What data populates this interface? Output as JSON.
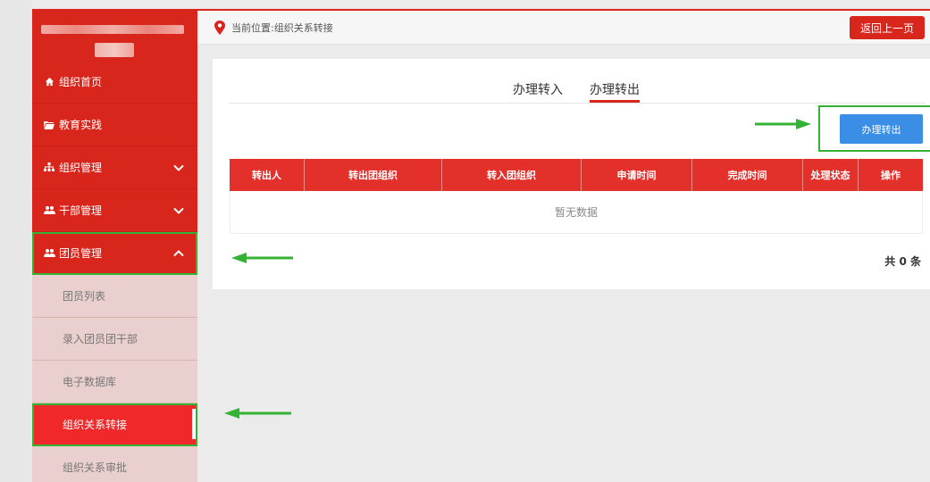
{
  "sidebar": {
    "menu": [
      {
        "label": "组织首页",
        "icon": "home-icon"
      },
      {
        "label": "教育实践",
        "icon": "folder-icon"
      },
      {
        "label": "组织管理",
        "icon": "sitemap-icon"
      },
      {
        "label": "干部管理",
        "icon": "users-icon"
      },
      {
        "label": "团员管理",
        "icon": "users-icon"
      }
    ],
    "submenu": [
      {
        "label": "团员列表"
      },
      {
        "label": "录入团员团干部"
      },
      {
        "label": "电子数据库"
      },
      {
        "label": "组织关系转接"
      },
      {
        "label": "组织关系审批"
      }
    ]
  },
  "header": {
    "breadcrumb": "当前位置:组织关系转接",
    "back_label": "返回上一页"
  },
  "tabs": [
    {
      "label": "办理转入"
    },
    {
      "label": "办理转出"
    }
  ],
  "action": {
    "label": "办理转出"
  },
  "table": {
    "columns": [
      "转出人",
      "转出团组织",
      "转入团组织",
      "申请时间",
      "完成时间",
      "处理状态",
      "操作"
    ],
    "empty_text": "暂无数据"
  },
  "pagination": {
    "total_label": "共 0 条"
  },
  "colors": {
    "brand": "#d9261c",
    "primary": "#3a8ee6",
    "annotation": "#34b233"
  }
}
